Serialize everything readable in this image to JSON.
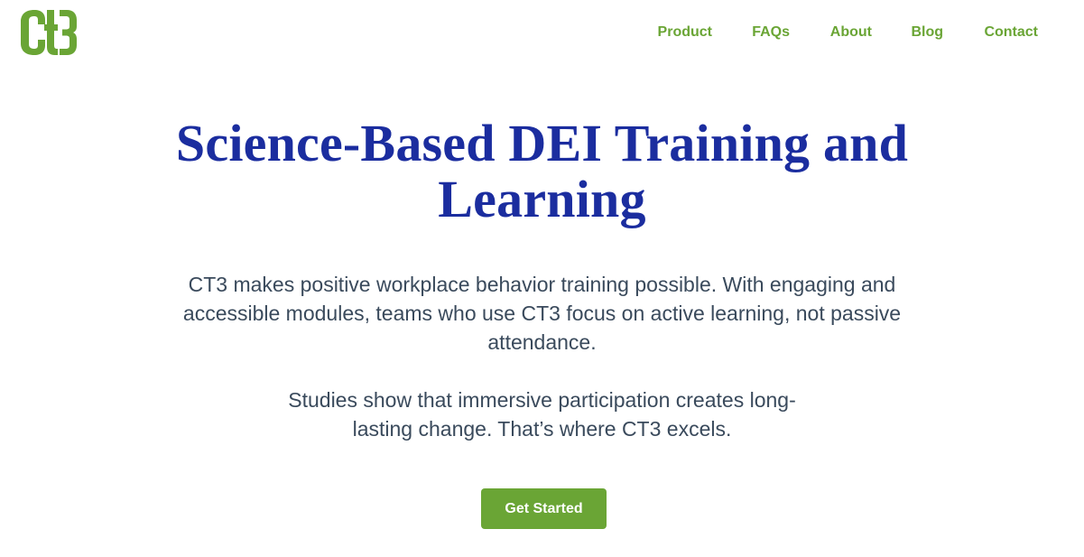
{
  "header": {
    "logo_text": "CT3",
    "nav": [
      {
        "label": "Product"
      },
      {
        "label": "FAQs"
      },
      {
        "label": "About"
      },
      {
        "label": "Blog"
      },
      {
        "label": "Contact"
      }
    ]
  },
  "hero": {
    "title": "Science-Based DEI Training and Learning",
    "paragraph_1": "CT3 makes positive workplace behavior training possible. With engaging and accessible modules, teams who use CT3 focus on active learning, not passive attendance.",
    "paragraph_2": "Studies show that immersive participation creates long-lasting change. That’s where CT3 excels.",
    "cta_label": "Get Started"
  },
  "colors": {
    "brand_green": "#6aa535",
    "title_blue": "#1b2d9f",
    "body_text": "#3a4a5c",
    "background": "#ffffff"
  }
}
